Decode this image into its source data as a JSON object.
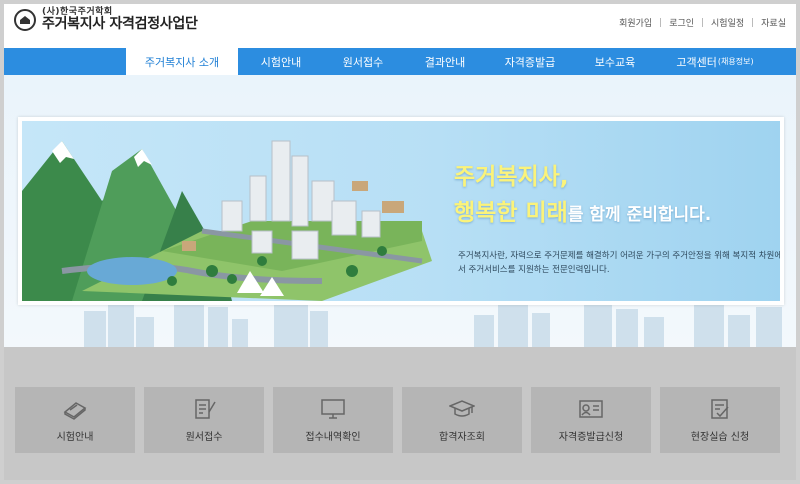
{
  "logo": {
    "org": "(사)한국주거학회",
    "title": "주거복지사 자격검정사업단"
  },
  "util_links": [
    "회원가입",
    "로그인",
    "시험일정",
    "자료실"
  ],
  "nav": {
    "items": [
      {
        "label": "주거복지사 소개",
        "active": true
      },
      {
        "label": "시험안내"
      },
      {
        "label": "원서접수"
      },
      {
        "label": "결과안내"
      },
      {
        "label": "자격증발급"
      },
      {
        "label": "보수교육"
      },
      {
        "label": "고객센터",
        "suffix": "(채용정보)"
      }
    ]
  },
  "banner": {
    "slogan_line1": "주거복지사,",
    "slogan_line2_a": "행복한 ",
    "slogan_line2_b": "미래",
    "slogan_line2_c": "를 ",
    "slogan_line2_d": "함께 준비합니다.",
    "description": "주거복지사란, 자력으로 주거문제를 해결하기 어려운 가구의 주거안정을 위해 복지적 차원에서 주거서비스를 지원하는 전문인력입니다."
  },
  "quick_menu": [
    {
      "label": "시험안내",
      "icon": "exam-book-icon"
    },
    {
      "label": "원서접수",
      "icon": "application-form-icon"
    },
    {
      "label": "접수내역확인",
      "icon": "monitor-icon"
    },
    {
      "label": "합격자조회",
      "icon": "graduation-cap-icon"
    },
    {
      "label": "자격증발급신청",
      "icon": "id-card-icon"
    },
    {
      "label": "현장실습 신청",
      "icon": "checklist-icon"
    }
  ],
  "colors": {
    "nav_bg": "#2c8de0",
    "accent_yellow": "#fbf37a",
    "quick_bg": "#c7c7c7",
    "quick_btn": "#b5b5b5"
  }
}
